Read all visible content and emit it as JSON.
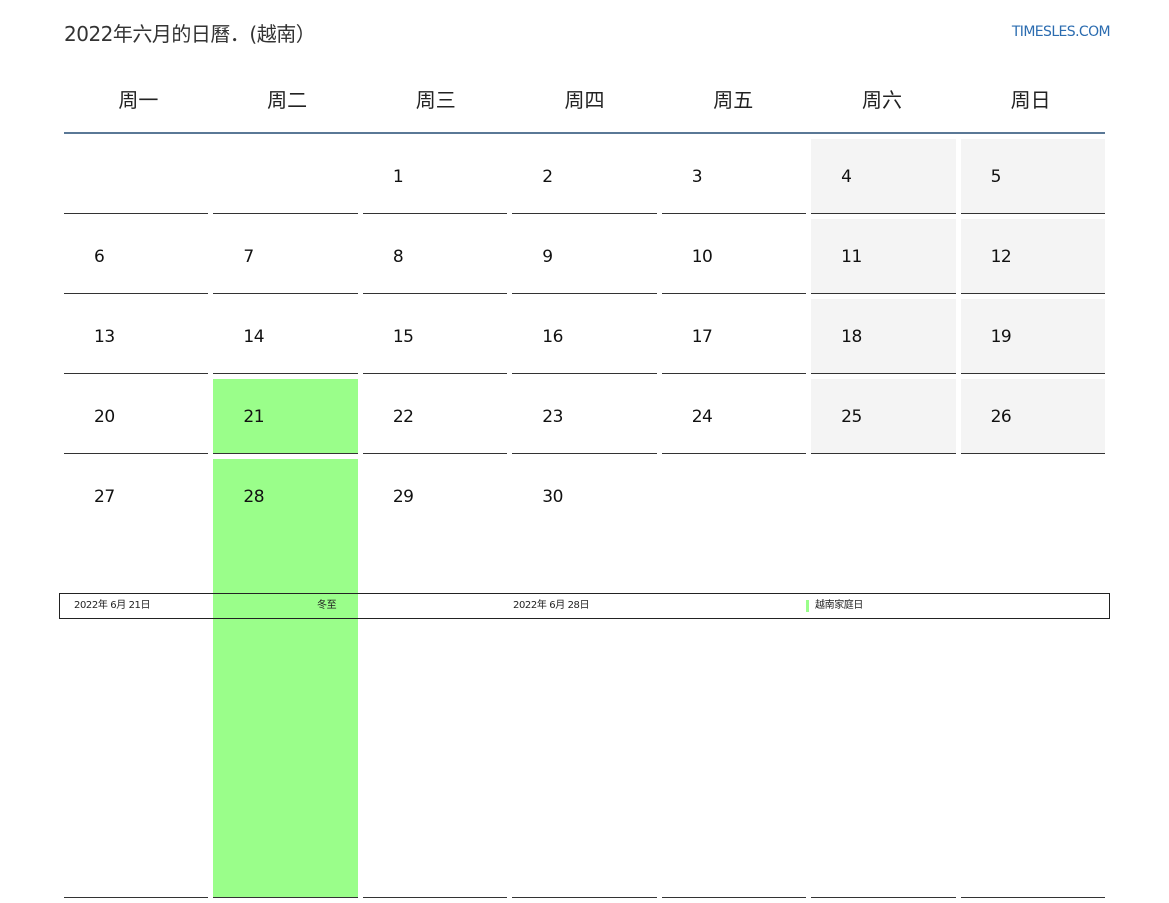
{
  "header": {
    "title": "2022年六月的日曆．(越南）",
    "site": "TIMESLES.COM"
  },
  "weekdays": [
    "周一",
    "周二",
    "周三",
    "周四",
    "周五",
    "周六",
    "周日"
  ],
  "calendar": {
    "weeks": [
      [
        "",
        "",
        "1",
        "2",
        "3",
        "4",
        "5"
      ],
      [
        "6",
        "7",
        "8",
        "9",
        "10",
        "11",
        "12"
      ],
      [
        "13",
        "14",
        "15",
        "16",
        "17",
        "18",
        "19"
      ],
      [
        "20",
        "21",
        "22",
        "23",
        "24",
        "25",
        "26"
      ],
      [
        "27",
        "28",
        "29",
        "30",
        "",
        "",
        ""
      ]
    ]
  },
  "legend": {
    "items": [
      {
        "date": "2022年 6月 21日",
        "name": "冬至"
      },
      {
        "date": "2022年 6月 28日",
        "name": "越南家庭日"
      }
    ]
  },
  "colors": {
    "holiday": "#9afe8a",
    "weekend": "#f4f4f4",
    "header_rule": "#5a7896",
    "link": "#2b6cb0"
  }
}
